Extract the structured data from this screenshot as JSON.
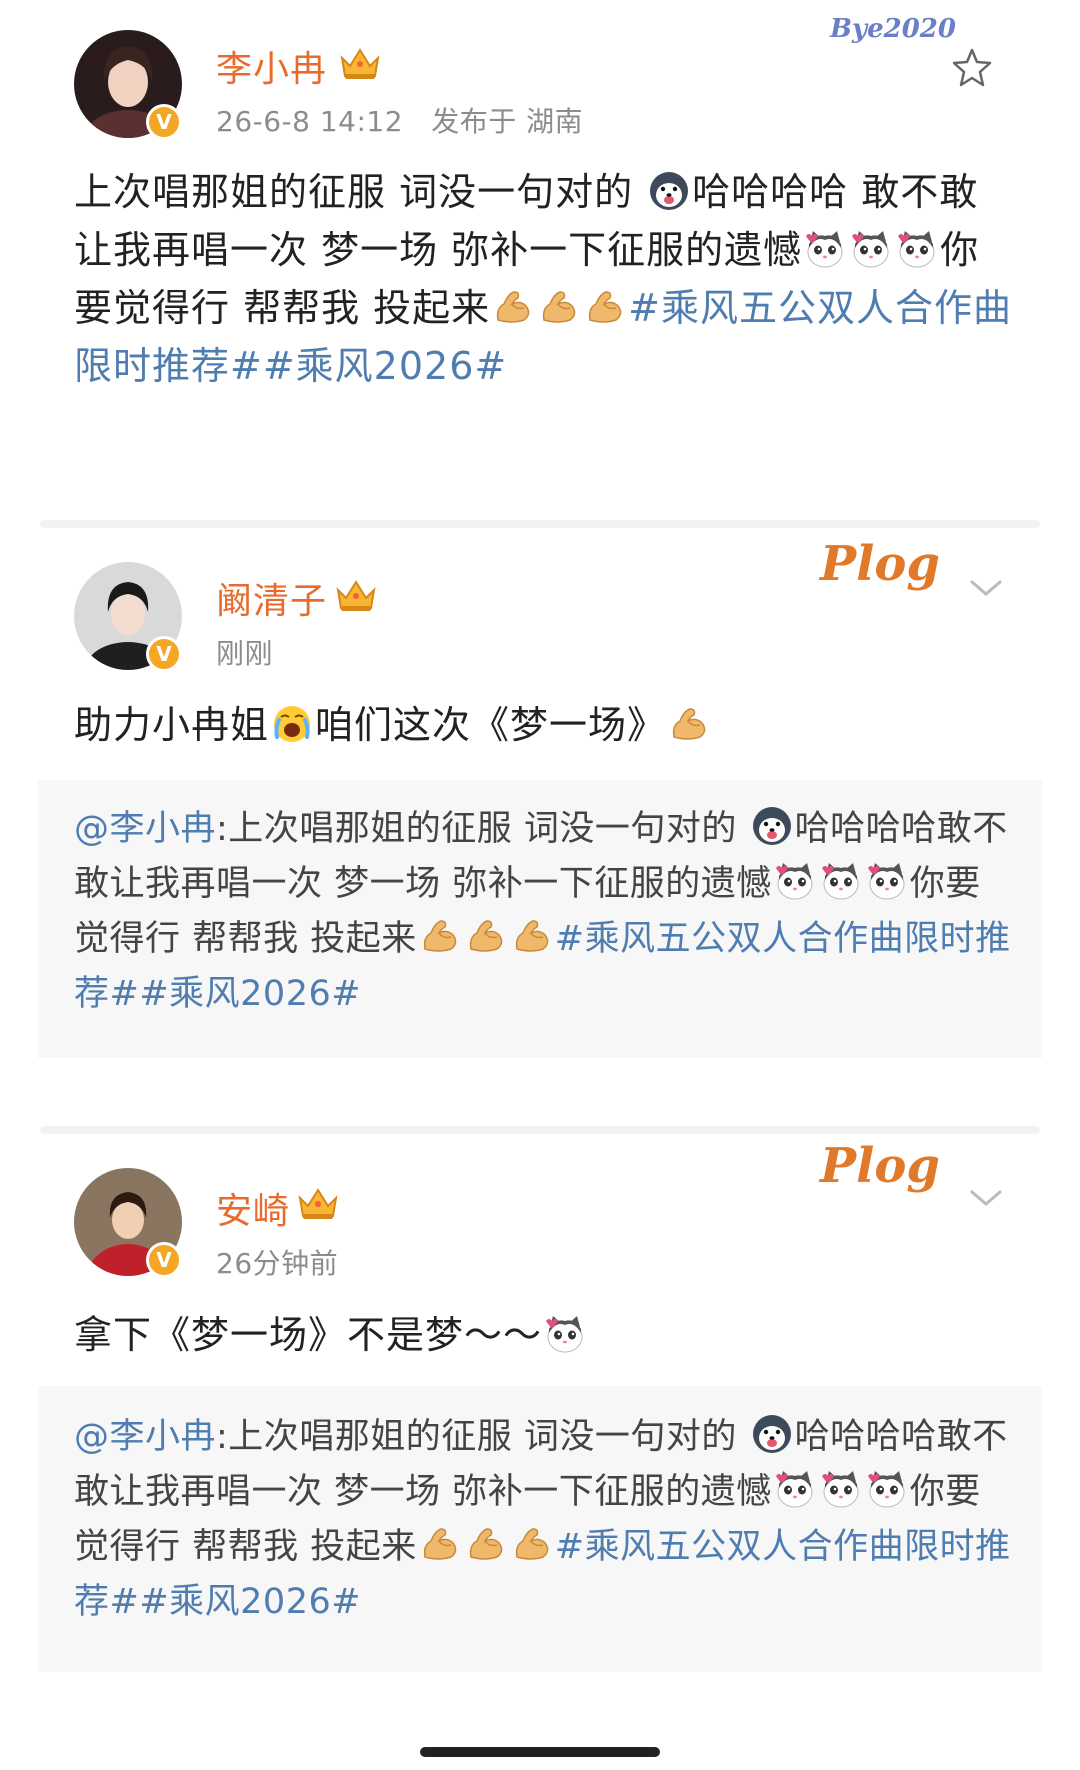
{
  "post1": {
    "username": "李小冉",
    "time": "26-6-8 14:12",
    "location": "发布于 湖南",
    "sticker": "Bye2020",
    "text_a": "上次唱那姐的征服 词没一句对的 ",
    "text_b": "哈哈哈哈 敢不敢让我再唱一次 梦一场 弥补一下征服的遗憾",
    "text_c": "你要觉得行 帮帮我 投起来",
    "topic1": "#乘风五公双人合作曲限时推荐#",
    "topic2": "#乘风2026#"
  },
  "post2": {
    "username": "阚清子",
    "time": "刚刚",
    "sticker": "Plog",
    "text_a": "助力小冉姐",
    "text_b": "咱们这次《梦一场》",
    "quote": {
      "mention": "@李小冉",
      "text_a": ":上次唱那姐的征服 词没一句对的 ",
      "text_b": "哈哈哈哈敢不敢让我再唱一次 梦一场 弥补一下征服的遗憾",
      "text_c": "你要觉得行 帮帮我 投起来",
      "topic1": "#乘风五公双人合作曲限时推荐#",
      "topic2": "#乘风2026#"
    }
  },
  "post3": {
    "username": "安崎",
    "time": "26分钟前",
    "sticker": "Plog",
    "text_a": "拿下《梦一场》不是梦～～",
    "quote": {
      "mention": "@李小冉",
      "text_a": ":上次唱那姐的征服 词没一句对的 ",
      "text_b": "哈哈哈哈敢不敢让我再唱一次 梦一场 弥补一下征服的遗憾",
      "text_c": "你要觉得行 帮帮我 投起来",
      "topic1": "#乘风五公双人合作曲限时推荐#",
      "topic2": "#乘风2026#"
    }
  },
  "colors": {
    "username": "#e86b2c",
    "topic": "#507daf",
    "meta": "#8c8c8c",
    "quote_bg": "#f7f7f7",
    "vbadge": "#f5a623"
  },
  "icons": [
    "crown-icon",
    "verified-badge-icon",
    "star-icon",
    "chevron-down-icon",
    "husky-emoji-icon",
    "cat-heart-emoji-icon",
    "muscle-emoji-icon",
    "crying-face-emoji-icon"
  ]
}
